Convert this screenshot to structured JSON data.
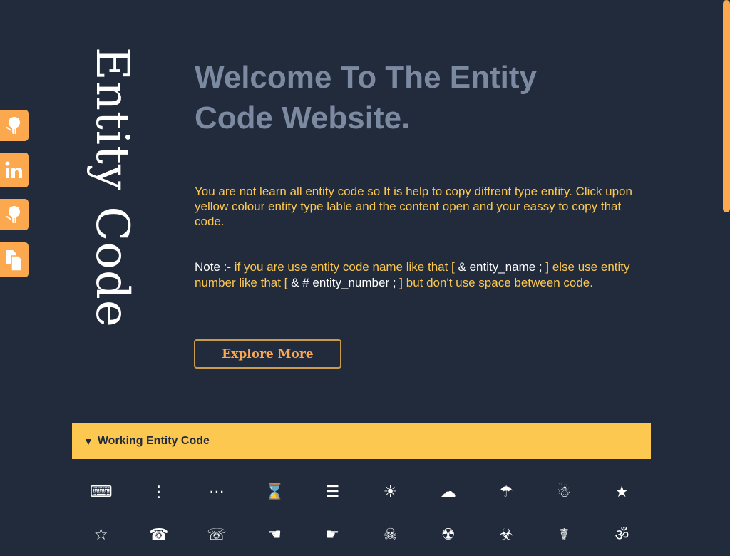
{
  "colors": {
    "background": "#212b3c",
    "accent_orange": "#fca84f",
    "accent_yellow": "#fdc850",
    "title_gray": "#7c8aa1",
    "white": "#ffffff"
  },
  "social_links": [
    {
      "icon": "github-icon"
    },
    {
      "icon": "linkedin-icon"
    },
    {
      "icon": "github-icon"
    },
    {
      "icon": "copy-pages-icon"
    }
  ],
  "brand": {
    "vertical_title": "Entity Code"
  },
  "hero": {
    "title": "Welcome To The Entity Code Website.",
    "intro": "You are not learn all entity code so It is help to copy diffrent type entity. Click upon yellow colour entity type lable and the content open and your eassy to copy that code.",
    "note": {
      "label": "Note :-",
      "part1": "if you are use entity code name like that [",
      "code1": "& entity_name ;",
      "part2": "] else use entity number like that [",
      "code2": "& # entity_number ;",
      "part3": "] but don't use space between code."
    },
    "explore_button": "Explore More"
  },
  "accordion": {
    "expanded_icon": "▼",
    "title": "Working Entity Code",
    "rows": [
      [
        "⌨",
        "⋮",
        "⋯",
        "⌛",
        "☰",
        "☀",
        "☁",
        "☂",
        "☃",
        "★"
      ],
      [
        "☆",
        "☎",
        "☏",
        "☚",
        "☛",
        "☠",
        "☢",
        "☣",
        "☤",
        "ॐ"
      ]
    ]
  },
  "scrollbar": {
    "position_fraction": 0.0,
    "visible_fraction": 0.39
  }
}
